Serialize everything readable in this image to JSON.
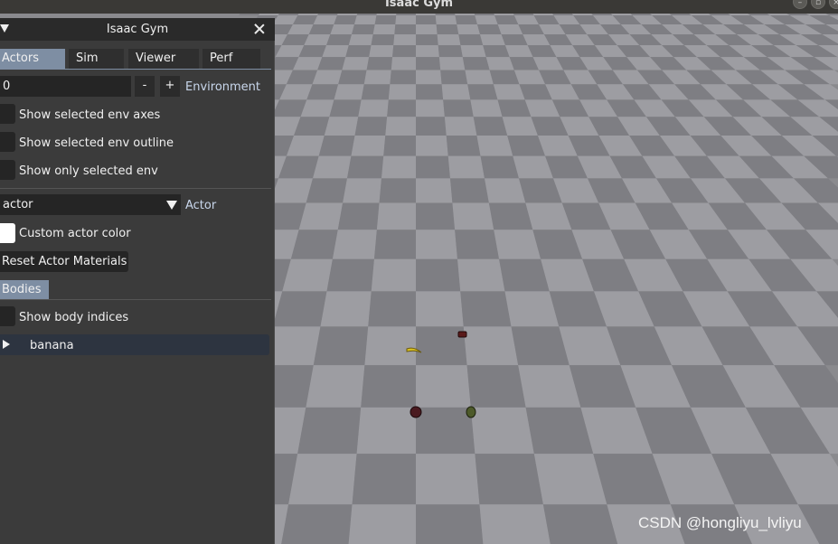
{
  "window": {
    "title": "Isaac Gym"
  },
  "panel": {
    "title": "Isaac Gym",
    "tabs": [
      {
        "label": "Actors",
        "active": true
      },
      {
        "label": "Sim",
        "active": false
      },
      {
        "label": "Viewer",
        "active": false
      },
      {
        "label": "Perf",
        "active": false
      }
    ],
    "environment": {
      "value": "0",
      "minus_label": "-",
      "plus_label": "+",
      "label": "Environment"
    },
    "env_checkboxes": [
      {
        "label": "Show selected env axes",
        "checked": false
      },
      {
        "label": "Show selected env outline",
        "checked": false
      },
      {
        "label": "Show only selected env",
        "checked": false
      }
    ],
    "actor": {
      "selected": "actor",
      "label": "Actor"
    },
    "custom_actor_color": {
      "label": "Custom actor color",
      "checked": false
    },
    "reset_button": "Reset Actor Materials",
    "bodies_header": "Bodies",
    "show_body_indices": {
      "label": "Show body indices",
      "checked": false
    },
    "tree_items": [
      {
        "label": "banana"
      }
    ]
  },
  "viewport": {
    "floor_colors": {
      "light": "#9d9da2",
      "dark": "#7e7e83"
    }
  },
  "watermark": "CSDN @hongliyu_lvliyu",
  "colors": {
    "panel_bg": "#3b3b3b",
    "accent": "#7e8ea3",
    "label_blue": "#c9d7ec"
  }
}
